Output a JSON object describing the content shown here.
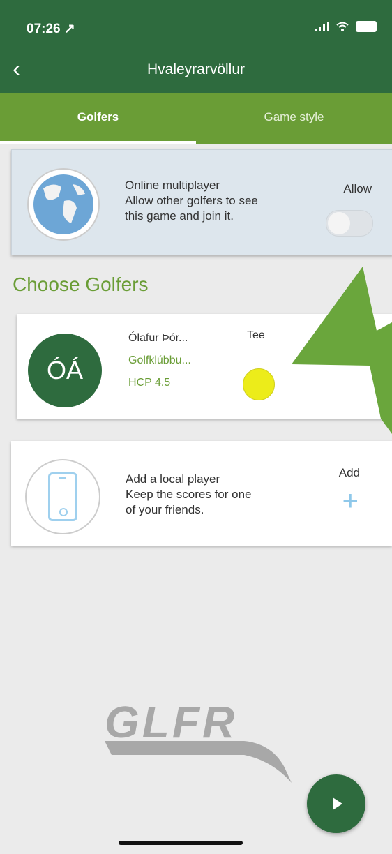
{
  "status": {
    "time": "07:26 ↗"
  },
  "nav": {
    "back_icon": "chevron-left-icon",
    "title": "Hvaleyrarvöllur"
  },
  "tabs": [
    {
      "label": "Golfers",
      "active": true
    },
    {
      "label": "Game style",
      "active": false
    }
  ],
  "multiplayer": {
    "title": "Online multiplayer",
    "desc_line1": "Allow other golfers to see",
    "desc_line2": "this game and join it.",
    "allow_label": "Allow",
    "allow_enabled": false,
    "icon": "globe-icon"
  },
  "section": {
    "title": "Choose Golfers"
  },
  "golfer": {
    "initials": "ÓÁ",
    "name": "Ólafur Þór...",
    "club": "Golfklúbbu...",
    "hcp": "HCP 4.5",
    "tee_label": "Tee",
    "tee_color": "#ecec1a"
  },
  "local_player": {
    "title": "Add a local player",
    "desc_line1": "Keep the scores for one",
    "desc_line2": "of your friends.",
    "add_label": "Add",
    "add_icon": "plus-icon",
    "icon": "phone-icon"
  },
  "logo": {
    "text": "GLFR"
  },
  "colors": {
    "primary": "#2e6b3e",
    "accent": "#6a9d36",
    "arrow": "#6aa63c"
  }
}
